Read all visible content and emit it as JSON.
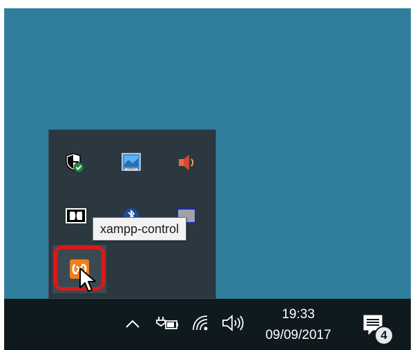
{
  "tooltip": {
    "text": "xampp-control"
  },
  "tray_icons": [
    {
      "name": "windows-defender-icon"
    },
    {
      "name": "intel-graphics-icon"
    },
    {
      "name": "volume-red-icon"
    },
    {
      "name": "dolby-icon"
    },
    {
      "name": "bluetooth-icon"
    },
    {
      "name": "gray-app-icon"
    },
    {
      "name": "xampp-control-icon"
    }
  ],
  "taskbar": {
    "time": "19:33",
    "date": "09/09/2017",
    "notification_count": "4",
    "icons": [
      "chevron-up-icon",
      "battery-icon",
      "wifi-icon",
      "speaker-icon",
      "action-center-icon"
    ]
  },
  "colors": {
    "desktop": "#2f7f9c",
    "taskbar": "#0f1a1f",
    "tray_popup": "#2c3840",
    "highlight_ring": "#e31717",
    "xampp_orange": "#f07c1a"
  }
}
